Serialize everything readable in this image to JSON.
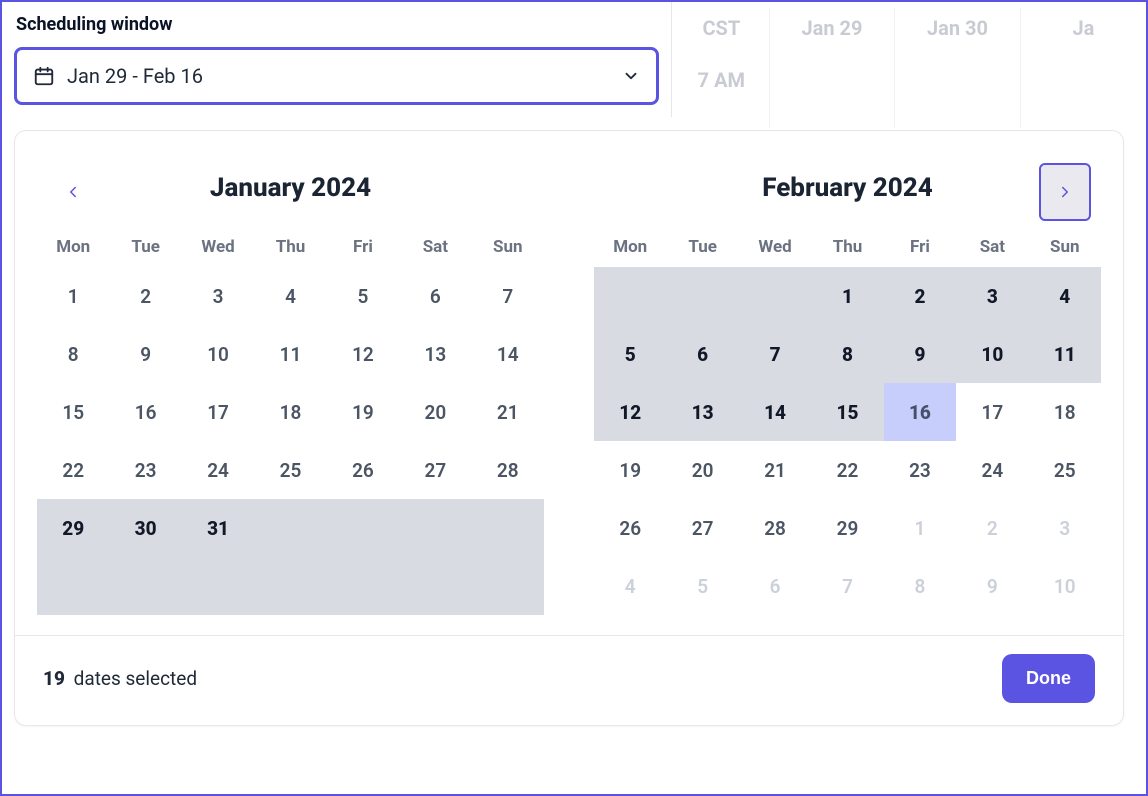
{
  "header": {
    "label": "Scheduling window",
    "range_text": "Jan 29 - Feb 16"
  },
  "background_calendar": {
    "timezone": "CST",
    "first_hour": "7 AM",
    "days": [
      "Jan 29",
      "Jan 30",
      "Ja"
    ]
  },
  "popover": {
    "dow": [
      "Mon",
      "Tue",
      "Wed",
      "Thu",
      "Fri",
      "Sat",
      "Sun"
    ],
    "months": [
      {
        "title": "January 2024"
      },
      {
        "title": "February 2024"
      }
    ],
    "january": {
      "leading_blanks": 0,
      "days": [
        {
          "n": 1,
          "sel": false
        },
        {
          "n": 2,
          "sel": false
        },
        {
          "n": 3,
          "sel": false
        },
        {
          "n": 4,
          "sel": false
        },
        {
          "n": 5,
          "sel": false
        },
        {
          "n": 6,
          "sel": false
        },
        {
          "n": 7,
          "sel": false
        },
        {
          "n": 8,
          "sel": false
        },
        {
          "n": 9,
          "sel": false
        },
        {
          "n": 10,
          "sel": false
        },
        {
          "n": 11,
          "sel": false
        },
        {
          "n": 12,
          "sel": false
        },
        {
          "n": 13,
          "sel": false
        },
        {
          "n": 14,
          "sel": false
        },
        {
          "n": 15,
          "sel": false
        },
        {
          "n": 16,
          "sel": false
        },
        {
          "n": 17,
          "sel": false
        },
        {
          "n": 18,
          "sel": false
        },
        {
          "n": 19,
          "sel": false
        },
        {
          "n": 20,
          "sel": false
        },
        {
          "n": 21,
          "sel": false
        },
        {
          "n": 22,
          "sel": false
        },
        {
          "n": 23,
          "sel": false
        },
        {
          "n": 24,
          "sel": false
        },
        {
          "n": 25,
          "sel": false
        },
        {
          "n": 26,
          "sel": false
        },
        {
          "n": 27,
          "sel": false
        },
        {
          "n": 28,
          "sel": false
        },
        {
          "n": 29,
          "sel": true
        },
        {
          "n": 30,
          "sel": true
        },
        {
          "n": 31,
          "sel": true
        }
      ],
      "trailing_selected_blanks": 4,
      "second_trailing_row_selected_blanks": 7
    },
    "february": {
      "leading_selected_blanks": 3,
      "days": [
        {
          "n": 1,
          "sel": true
        },
        {
          "n": 2,
          "sel": true
        },
        {
          "n": 3,
          "sel": true
        },
        {
          "n": 4,
          "sel": true
        },
        {
          "n": 5,
          "sel": true
        },
        {
          "n": 6,
          "sel": true
        },
        {
          "n": 7,
          "sel": true
        },
        {
          "n": 8,
          "sel": true
        },
        {
          "n": 9,
          "sel": true
        },
        {
          "n": 10,
          "sel": true
        },
        {
          "n": 11,
          "sel": true
        },
        {
          "n": 12,
          "sel": true
        },
        {
          "n": 13,
          "sel": true
        },
        {
          "n": 14,
          "sel": true
        },
        {
          "n": 15,
          "sel": true
        },
        {
          "n": 16,
          "sel": true,
          "endcap": true
        },
        {
          "n": 17,
          "sel": false
        },
        {
          "n": 18,
          "sel": false
        },
        {
          "n": 19,
          "sel": false
        },
        {
          "n": 20,
          "sel": false
        },
        {
          "n": 21,
          "sel": false
        },
        {
          "n": 22,
          "sel": false
        },
        {
          "n": 23,
          "sel": false
        },
        {
          "n": 24,
          "sel": false
        },
        {
          "n": 25,
          "sel": false
        },
        {
          "n": 26,
          "sel": false
        },
        {
          "n": 27,
          "sel": false
        },
        {
          "n": 28,
          "sel": false
        },
        {
          "n": 29,
          "sel": false
        }
      ],
      "trailing_disabled": [
        1,
        2,
        3,
        4,
        5,
        6,
        7,
        8,
        9,
        10
      ]
    },
    "footer": {
      "count": "19",
      "count_suffix": "dates selected",
      "done": "Done"
    }
  }
}
